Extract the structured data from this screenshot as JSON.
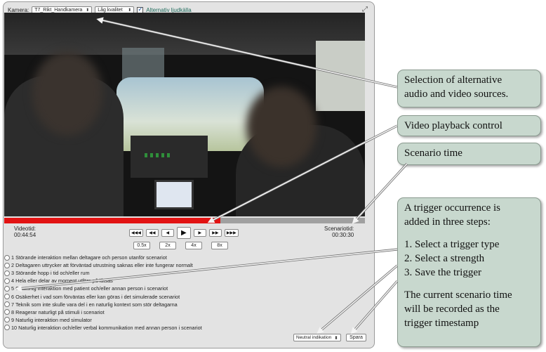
{
  "topbar": {
    "camera_label": "Kamera:",
    "camera_value": "T7_Rikt_Handkamera",
    "quality_value": "Låg kvalitet",
    "alt_audio_label": "Alternativ ljudkälla",
    "alt_audio_checked": true
  },
  "playback": {
    "progress_fraction": 0.6,
    "video_time_label": "Videotid:",
    "video_time": "00:44:54",
    "scenario_time_label": "Scenariotid:",
    "scenario_time": "00:30:30",
    "buttons": [
      "◀◀◀",
      "◀◀",
      "◀",
      "▶",
      "▶",
      "▶▶",
      "▶▶▶"
    ],
    "speeds": [
      "0.5x",
      "2x",
      "4x",
      "8x"
    ]
  },
  "triggers": [
    "1 Störande interaktion mellan deltagare och person utanför scenariot",
    "2 Deltagaren uttrycker att förväntad utrustning saknas eller inte fungerar normalt",
    "3 Störande hopp i tid och/eller rum",
    "4 Hela eller delar av moment utförs på låtsas",
    "5 Onaturlig interaktion med patient och/eller annan person i scenariot",
    "6 Osäkerhet i vad som förväntas eller kan göras i det simulerade scenariot",
    "7 Teknik som inte skulle vara del i en naturlig kontext som stör deltagarna",
    "8 Reagerar naturligt på stimuli i scenariot",
    "9 Naturlig interaktion med simulator",
    "10 Naturlig interaktion och/eller verbal kommunikation med annan person i scenariot"
  ],
  "strength_select": "Neutral indikation",
  "save_label": "Spara",
  "callouts": {
    "sources": [
      "Selection of alternative",
      "audio and video sources."
    ],
    "playback": "Video playback control",
    "scenario_time": "Scenario time",
    "trigger": {
      "intro": [
        "A trigger occurrence is",
        "added in three steps:"
      ],
      "steps": [
        "1. Select a trigger type",
        "2. Select a strength",
        "3. Save the trigger"
      ],
      "note": [
        "The current scenario time",
        "will be recorded as the",
        "trigger timestamp"
      ]
    }
  },
  "colors": {
    "progress": "#e21313",
    "callout_bg": "#c8d8ce",
    "alt_label": "#1f6b5c"
  }
}
